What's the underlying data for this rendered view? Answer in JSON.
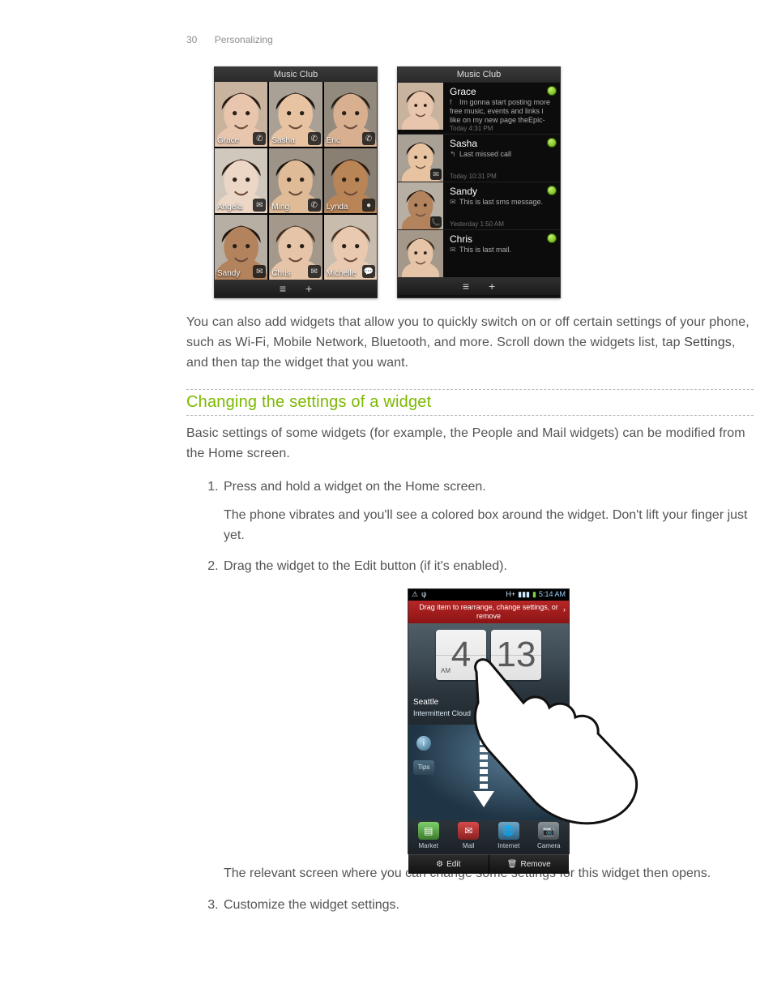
{
  "header": {
    "page_number": "30",
    "section": "Personalizing"
  },
  "phoneA": {
    "title": "Music Club",
    "contacts": [
      {
        "name": "Grace",
        "icon": "phone",
        "skin": "#e8c6ae",
        "hair": "#2a1a12",
        "bg": "#c8b49e"
      },
      {
        "name": "Sasha",
        "icon": "phone",
        "skin": "#e7c3a2",
        "hair": "#1b1410",
        "bg": "#a9a096"
      },
      {
        "name": "Eric",
        "icon": "phone",
        "skin": "#d8b090",
        "hair": "#2c2118",
        "bg": "#938a7e"
      },
      {
        "name": "Angela",
        "icon": "mail",
        "skin": "#ecd6c5",
        "hair": "#2a1d15",
        "bg": "#d1c8bd"
      },
      {
        "name": "Ming",
        "icon": "phone",
        "skin": "#dfbb97",
        "hair": "#17120e",
        "bg": "#9e9387"
      },
      {
        "name": "Lynda",
        "icon": "dot",
        "skin": "#b98456",
        "hair": "#2a1a0f",
        "bg": "#8a7f73"
      },
      {
        "name": "Sandy",
        "icon": "mail",
        "skin": "#b2835c",
        "hair": "#1e140d",
        "bg": "#b8afa4"
      },
      {
        "name": "Chris",
        "icon": "mail",
        "skin": "#e5c4a7",
        "hair": "#402d1e",
        "bg": "#a4988a"
      },
      {
        "name": "Michelle",
        "icon": "chat",
        "skin": "#e9cab0",
        "hair": "#4a3320",
        "bg": "#c7bcae"
      }
    ],
    "menu_glyph": "≡",
    "add_glyph": "+"
  },
  "phoneB": {
    "title": "Music Club",
    "items": [
      {
        "name": "Grace",
        "msg": "Im gonna start posting more free music, events and links i like on my new page theEpic-",
        "time": "Today 4:31 PM",
        "pre": "f",
        "skin": "#e8c6ae",
        "hair": "#2a1a12",
        "bg": "#c8b49e"
      },
      {
        "name": "Sasha",
        "msg": "Last missed call",
        "time": "Today 10:31 PM",
        "pre": "↰",
        "thumb_icon": "✉",
        "skin": "#e7c3a2",
        "hair": "#1b1410",
        "bg": "#a9a096"
      },
      {
        "name": "Sandy",
        "msg": "This is last sms message.",
        "time": "Yesterday 1:50 AM",
        "pre": "✉",
        "thumb_icon": "📞",
        "skin": "#b2835c",
        "hair": "#1e140d",
        "bg": "#b8afa4"
      },
      {
        "name": "Chris",
        "msg": "This is last mail.",
        "time": "",
        "pre": "✉",
        "skin": "#e5c4a7",
        "hair": "#402d1e",
        "bg": "#a4988a"
      }
    ],
    "menu_glyph": "≡",
    "add_glyph": "+"
  },
  "para_widgets_a": "You can also add widgets that allow you to quickly switch on or off certain settings of your phone, such as Wi-Fi, Mobile Network, Bluetooth, and more. Scroll down the widgets list, tap ",
  "para_widgets_b_bold": "Settings",
  "para_widgets_c": ", and then tap the widget that you want.",
  "section_heading": "Changing the settings of a widget",
  "section_intro": "Basic settings of some widgets (for example, the People and Mail widgets) can be modified from the Home screen.",
  "steps": {
    "s1": "Press and hold a widget on the Home screen.",
    "s1b": "The phone vibrates and you'll see a colored box around the widget. Don't lift your finger just yet.",
    "s2a": "Drag the widget to the ",
    "s2b_bold": "Edit",
    "s2c": " button (if it's enabled).",
    "s2_after": "The relevant screen where you can change some settings for this widget then opens.",
    "s3": "Customize the widget settings."
  },
  "phoneC": {
    "status_time": "5:14 AM",
    "redbar": "Drag item to rearrange, change settings, or remove",
    "clock_h": "4",
    "clock_m": "13",
    "ampm": "AM",
    "city": "Seattle",
    "weather": "Intermittent Cloud",
    "tips": "Tips",
    "dock": [
      "Market",
      "Mail",
      "Internet",
      "Camera"
    ],
    "edit": "Edit",
    "remove": "Remove"
  }
}
